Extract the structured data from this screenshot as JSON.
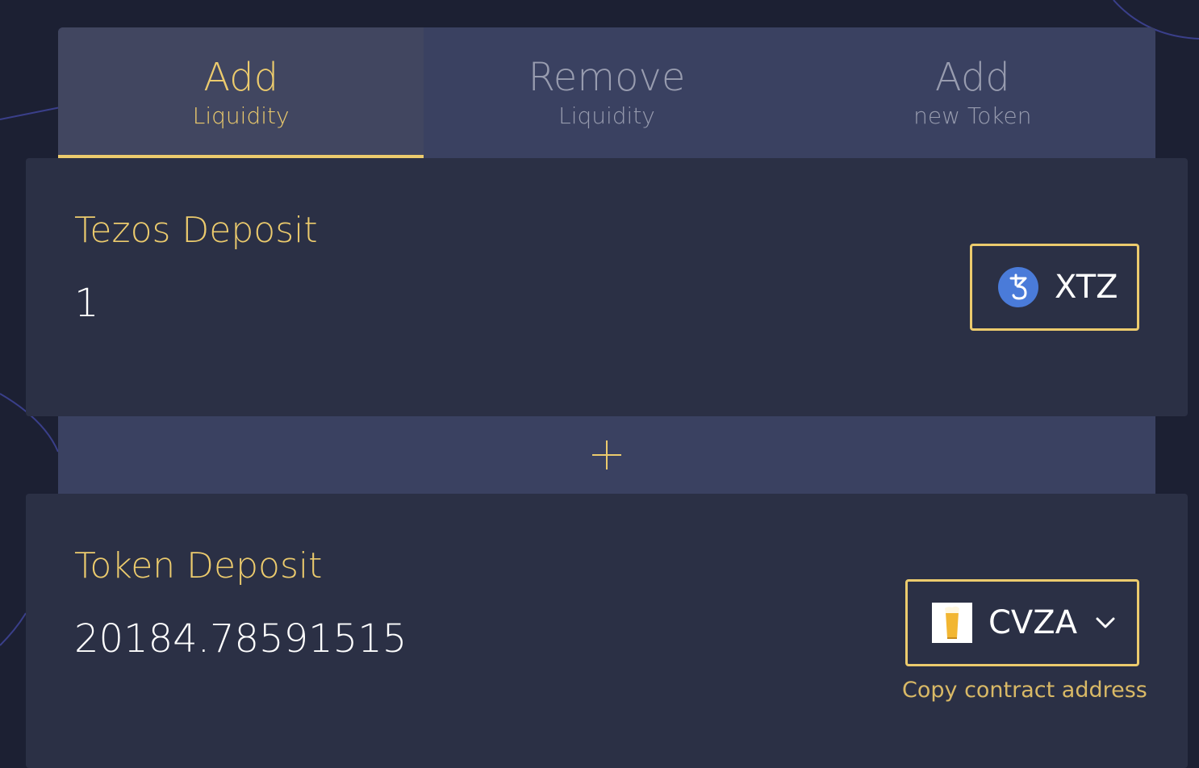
{
  "tabs": [
    {
      "title": "Add",
      "subtitle": "Liquidity",
      "active": true
    },
    {
      "title": "Remove",
      "subtitle": "Liquidity",
      "active": false
    },
    {
      "title": "Add",
      "subtitle": "new Token",
      "active": false
    }
  ],
  "tezos_deposit": {
    "label": "Tezos Deposit",
    "value": "1",
    "token": {
      "symbol": "XTZ",
      "icon": "tezos-icon"
    }
  },
  "divider": {
    "icon": "plus-icon"
  },
  "token_deposit": {
    "label": "Token Deposit",
    "value": "20184.78591515",
    "token": {
      "symbol": "CVZA",
      "icon": "beer-icon"
    },
    "copy_link": "Copy contract address"
  },
  "colors": {
    "accent": "#eccb6d",
    "background": "#1c2033",
    "panel": "#2b3045",
    "tab_bar": "#3a4161",
    "xtz_logo": "#4a7bd9"
  }
}
